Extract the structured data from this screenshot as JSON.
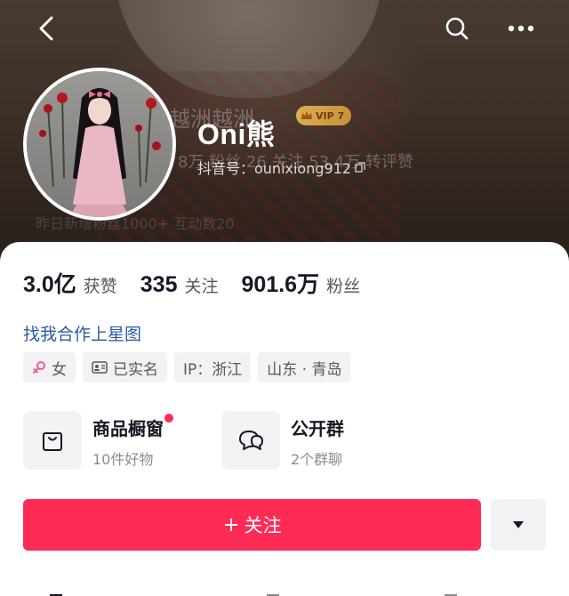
{
  "header": {
    "back_icon": "chevron-left-icon",
    "search_icon": "search-icon",
    "more_icon": "more-dots-icon"
  },
  "banner_ghost": {
    "name_echo": "越洲越洲",
    "stats_echo": "8万  粉丝   26  关注   53.4万  转评赞",
    "bottom_echo": "昨日新增粉丝1000+   互动数20"
  },
  "profile": {
    "display_name": "Oni熊",
    "vip_label": "VIP 7",
    "douyin_id": "抖音号：ounixiong912",
    "colors": {
      "accent": "#fe2c55",
      "link": "#2a5aa8",
      "vip": "#e0a23a"
    }
  },
  "stats": [
    {
      "value": "3.0亿",
      "label": "获赞"
    },
    {
      "value": "335",
      "label": "关注"
    },
    {
      "value": "901.6万",
      "label": "粉丝"
    }
  ],
  "xingtu_link": "找我合作上星图",
  "tags": [
    {
      "icon": "female-icon",
      "label": "女"
    },
    {
      "icon": "id-card-icon",
      "label": "已实名"
    },
    {
      "icon": "",
      "label": "IP：浙江"
    },
    {
      "icon": "",
      "label": "山东 · 青岛"
    }
  ],
  "shortcuts": [
    {
      "icon": "shopping-bag-icon",
      "title": "商品橱窗",
      "subtitle": "10件好物",
      "has_dot": true
    },
    {
      "icon": "group-chat-icon",
      "title": "公开群",
      "subtitle": "2个群聊",
      "has_dot": false
    }
  ],
  "follow_button": {
    "label": "关注",
    "icon": "plus-icon"
  },
  "more_button": {
    "icon": "triangle-down-icon"
  }
}
